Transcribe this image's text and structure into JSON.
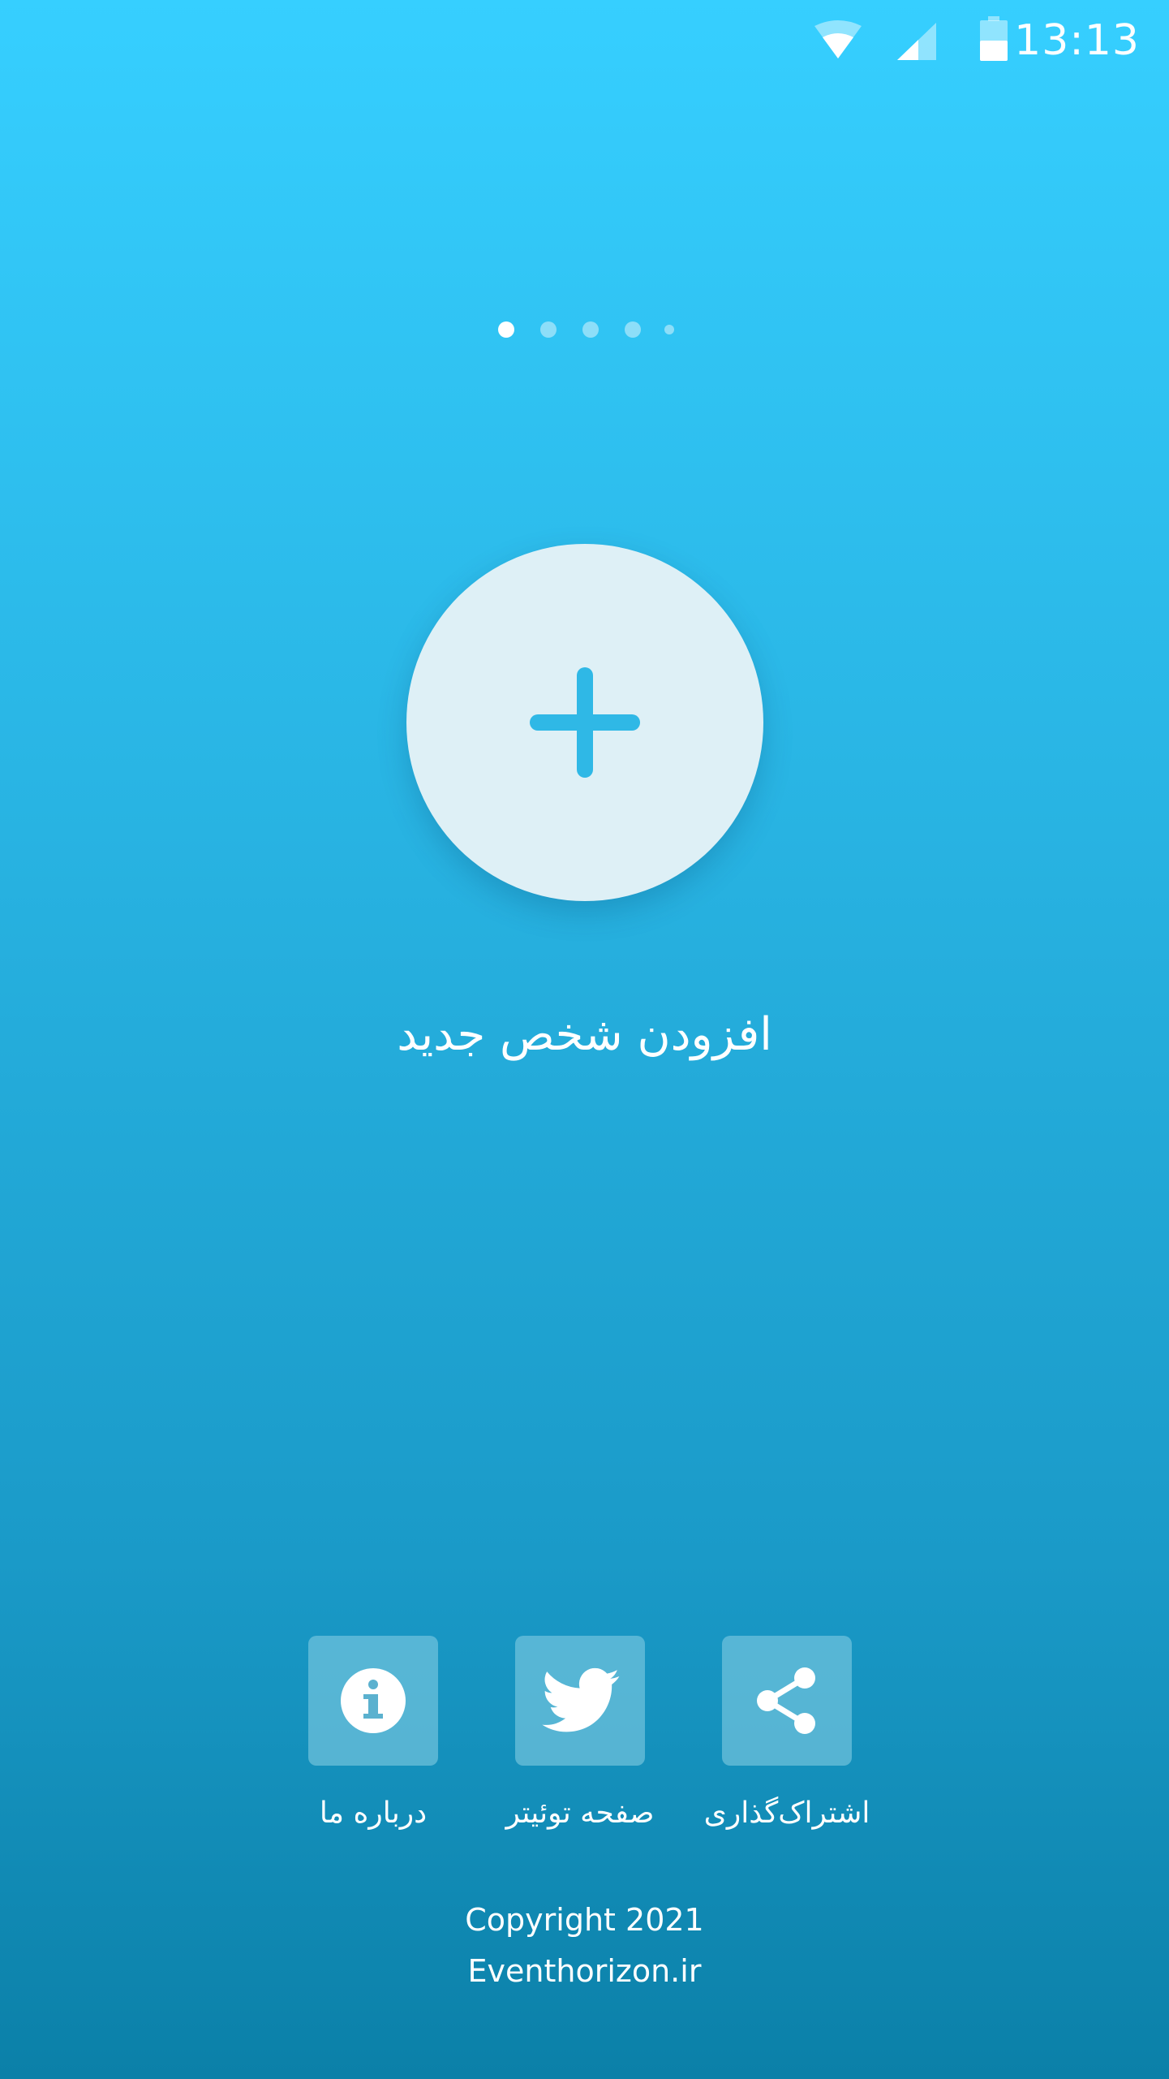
{
  "status_bar": {
    "time": "13:13",
    "icons": [
      "wifi-icon",
      "cellular-signal-icon",
      "battery-icon"
    ]
  },
  "pager": {
    "count": 5,
    "active_index": 0
  },
  "main": {
    "add_button_icon": "plus-icon",
    "add_person_label": "افزودن شخص جدید"
  },
  "actions": [
    {
      "icon": "info-icon",
      "label": "درباره ما"
    },
    {
      "icon": "twitter-icon",
      "label": "صفحه توئیتر"
    },
    {
      "icon": "share-icon",
      "label": "اشتراک‌گذاری"
    }
  ],
  "footer": {
    "copyright": "Copyright 2021",
    "website": "Eventhorizon.ir"
  },
  "colors": {
    "gradient_top": "#36CFFF",
    "gradient_bottom": "#0B80A8",
    "button_fill": "#DEF0F6",
    "accent": "#2FB8E6"
  }
}
